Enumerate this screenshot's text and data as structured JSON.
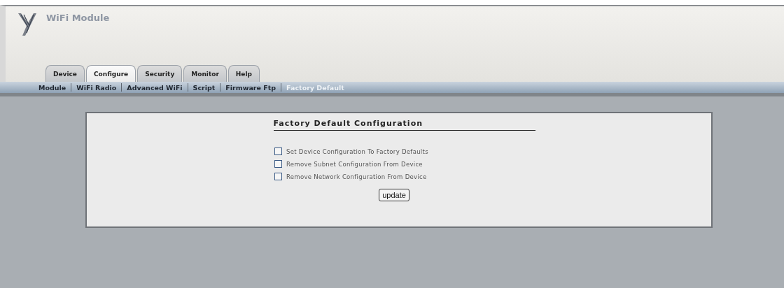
{
  "header": {
    "title": "WiFi Module"
  },
  "tabs": [
    {
      "label": "Device",
      "selected": false
    },
    {
      "label": "Configure",
      "selected": true
    },
    {
      "label": "Security",
      "selected": false
    },
    {
      "label": "Monitor",
      "selected": false
    },
    {
      "label": "Help",
      "selected": false
    }
  ],
  "subnav": [
    {
      "label": "Module",
      "selected": false
    },
    {
      "label": "WiFi Radio",
      "selected": false
    },
    {
      "label": "Advanced WiFi",
      "selected": false
    },
    {
      "label": "Script",
      "selected": false
    },
    {
      "label": "Firmware Ftp",
      "selected": false
    },
    {
      "label": "Factory Default",
      "selected": true
    }
  ],
  "form": {
    "title": "Factory Default Configuration",
    "options": [
      {
        "label": "Set Device Configuration To Factory Defaults",
        "checked": false
      },
      {
        "label": "Remove Subnet Configuration From Device",
        "checked": false
      },
      {
        "label": "Remove Network Configuration From Device",
        "checked": false
      }
    ],
    "button": "update"
  }
}
